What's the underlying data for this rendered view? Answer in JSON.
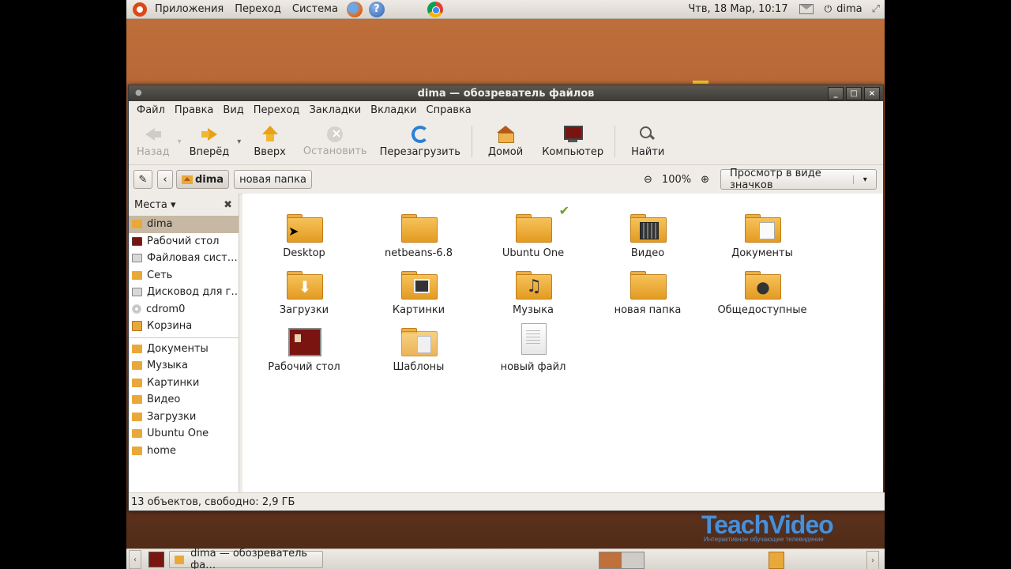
{
  "top_panel": {
    "menus": [
      "Приложения",
      "Переход",
      "Система"
    ],
    "clock": "Чтв, 18 Мар, 10:17",
    "user": "dima",
    "help_glyph": "?"
  },
  "window": {
    "title": "dima — обозреватель файлов",
    "controls": {
      "minimize": "_",
      "maximize": "□",
      "close": "×"
    },
    "menubar": [
      "Файл",
      "Правка",
      "Вид",
      "Переход",
      "Закладки",
      "Вкладки",
      "Справка"
    ],
    "toolbar": {
      "back": "Назад",
      "forward": "Вперёд",
      "up": "Вверх",
      "stop": "Остановить",
      "reload": "Перезагрузить",
      "home": "Домой",
      "computer": "Компьютер",
      "find": "Найти"
    },
    "location": {
      "crumb_current": "dima",
      "crumb_next": "новая папка",
      "zoom_level": "100%",
      "view_mode": "Просмотр в виде значков"
    },
    "sidebar": {
      "header": "Места",
      "places": [
        {
          "label": "dima",
          "icon": "home-folder-icon"
        },
        {
          "label": "Рабочий стол",
          "icon": "desktop-icon"
        },
        {
          "label": "Файловая сист…",
          "icon": "drive-icon"
        },
        {
          "label": "Сеть",
          "icon": "network-icon"
        },
        {
          "label": "Дисковод для г…",
          "icon": "floppy-icon"
        },
        {
          "label": "cdrom0",
          "icon": "cdrom-icon"
        },
        {
          "label": "Корзина",
          "icon": "trash-icon"
        }
      ],
      "bookmarks": [
        {
          "label": "Документы"
        },
        {
          "label": "Музыка"
        },
        {
          "label": "Картинки"
        },
        {
          "label": "Видео"
        },
        {
          "label": "Загрузки"
        },
        {
          "label": "Ubuntu One"
        },
        {
          "label": "home"
        }
      ]
    },
    "files": [
      {
        "label": "Desktop",
        "type": "folder"
      },
      {
        "label": "netbeans-6.8",
        "type": "folder"
      },
      {
        "label": "Ubuntu One",
        "type": "folder",
        "emblem": "checkmark-icon"
      },
      {
        "label": "Видео",
        "type": "folder",
        "emblem": "film-icon"
      },
      {
        "label": "Документы",
        "type": "folder",
        "emblem": "document-icon"
      },
      {
        "label": "Загрузки",
        "type": "folder",
        "emblem": "download-arrow-icon"
      },
      {
        "label": "Картинки",
        "type": "folder",
        "emblem": "picture-icon"
      },
      {
        "label": "Музыка",
        "type": "folder",
        "emblem": "music-note-icon"
      },
      {
        "label": "новая папка",
        "type": "folder"
      },
      {
        "label": "Общедоступные",
        "type": "folder",
        "emblem": "person-icon"
      },
      {
        "label": "Рабочий стол",
        "type": "desktop"
      },
      {
        "label": "Шаблоны",
        "type": "folder",
        "emblem": "template-icon"
      },
      {
        "label": "новый файл",
        "type": "file"
      }
    ],
    "status": "13 объектов, свободно: 2,9 ГБ"
  },
  "bottom_panel": {
    "task": "dima — обозреватель фа…"
  },
  "watermark": {
    "brand": "TeachVideo",
    "tagline": "Интерактивное обучающее телевидение"
  }
}
